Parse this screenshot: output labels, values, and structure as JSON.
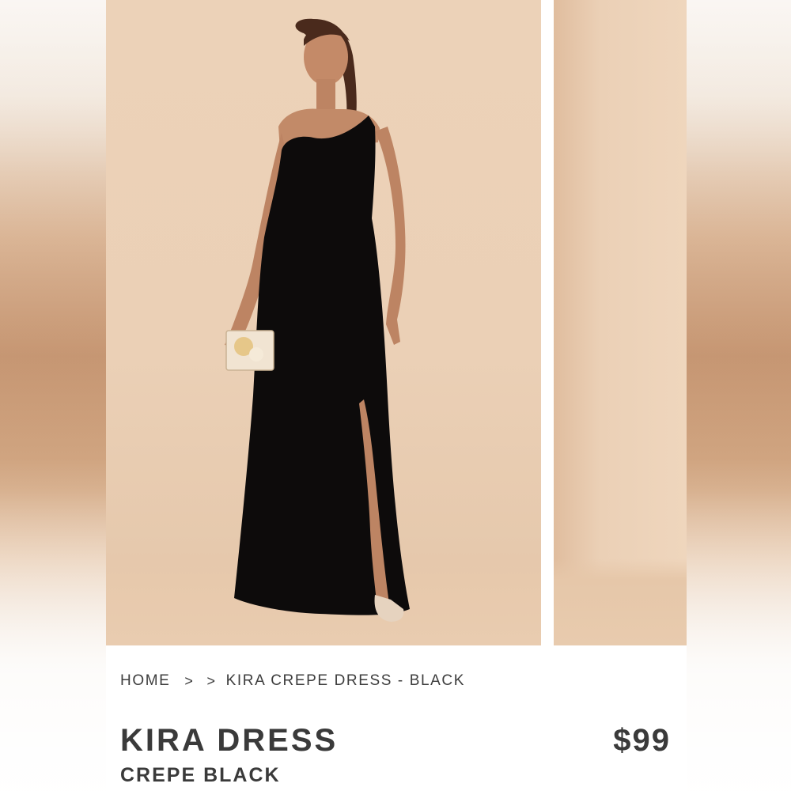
{
  "breadcrumb": {
    "home": "HOME",
    "separator": ">",
    "current": "KIRA CREPE DRESS - BLACK"
  },
  "product": {
    "name": "KIRA DRESS",
    "variant": "CREPE BLACK",
    "price": "$99"
  },
  "gallery": {
    "main_image": "model-in-one-shoulder-black-gown-photo",
    "secondary_image": "beige-backdrop-photo"
  },
  "colors": {
    "backdrop": "#ebd0b6",
    "dress": "#0d0b0b",
    "text": "#3a3a3a",
    "card": "#ffffff"
  }
}
